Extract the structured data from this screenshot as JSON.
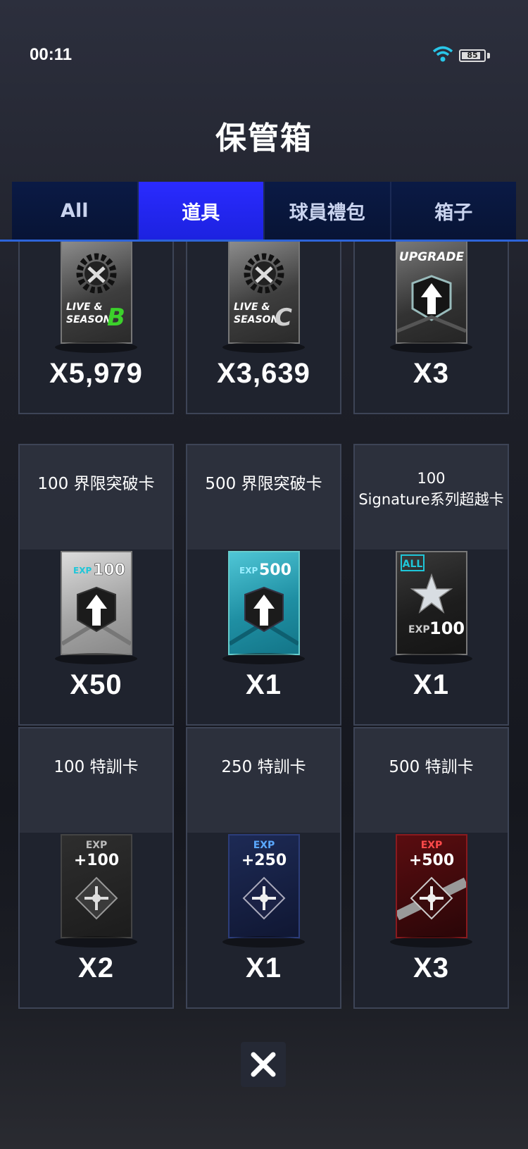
{
  "status": {
    "time": "00:11",
    "battery": "85",
    "battery_level": 0.85
  },
  "title": "保管箱",
  "tabs": [
    {
      "label": "All",
      "active": false
    },
    {
      "label": "道具",
      "active": true
    },
    {
      "label": "球員禮包",
      "active": false
    },
    {
      "label": "箱子",
      "active": false
    }
  ],
  "items": [
    {
      "label": "",
      "qty": "X5,979",
      "icon": "live-season-b-card",
      "card_text": [
        "LIVE &",
        "SEASON",
        "B"
      ]
    },
    {
      "label": "",
      "qty": "X3,639",
      "icon": "live-season-c-card",
      "card_text": [
        "LIVE &",
        "SEASON",
        "C"
      ]
    },
    {
      "label": "",
      "qty": "X3",
      "icon": "upgrade-card",
      "card_text": [
        "UPGRADE"
      ]
    },
    {
      "label": "100 界限突破卡",
      "qty": "X50",
      "icon": "limit-break-100-card",
      "card_text": [
        "EXP",
        "100"
      ]
    },
    {
      "label": "500 界限突破卡",
      "qty": "X1",
      "icon": "limit-break-500-card",
      "card_text": [
        "EXP",
        "500"
      ]
    },
    {
      "label": "100\nSignature系列超越卡",
      "label_line1": "100",
      "label_line2": "Signature系列超越卡",
      "qty": "X1",
      "icon": "signature-exceed-card",
      "card_text": [
        "ALL",
        "EXP",
        "100"
      ]
    },
    {
      "label": "100 特訓卡",
      "qty": "X2",
      "icon": "training-100-card",
      "card_text": [
        "EXP",
        "+100"
      ]
    },
    {
      "label": "250 特訓卡",
      "qty": "X1",
      "icon": "training-250-card",
      "card_text": [
        "EXP",
        "+250"
      ]
    },
    {
      "label": "500 特訓卡",
      "qty": "X3",
      "icon": "training-500-card",
      "card_text": [
        "EXP",
        "+500"
      ]
    }
  ],
  "close_icon": "close-icon",
  "colors": {
    "active_tab": "#2a2bff",
    "tab_bg": "#0a1a45",
    "accent_line": "#2d64d9"
  }
}
